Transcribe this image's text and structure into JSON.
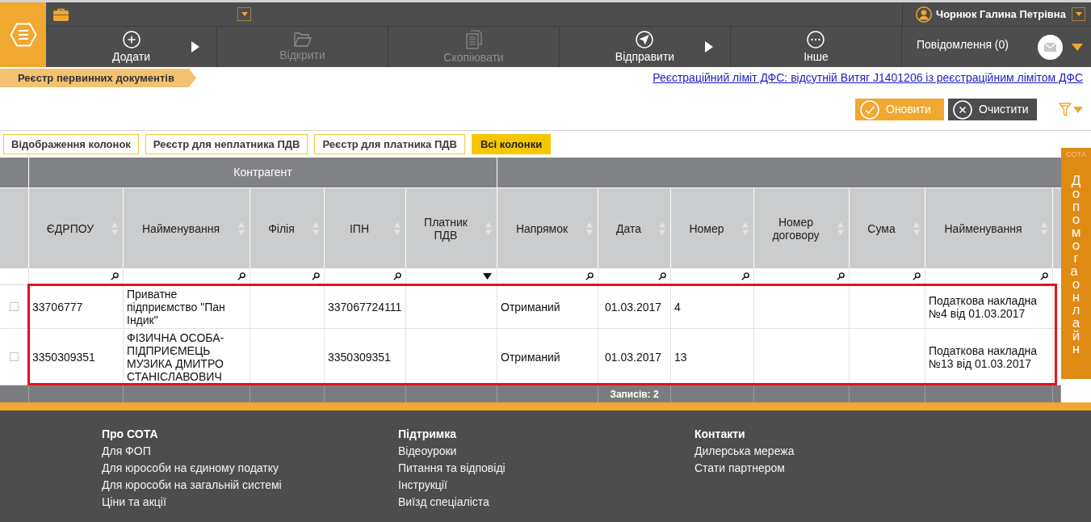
{
  "app_bar": {
    "user_name": "Чорнюк Галина Петрівна",
    "toolbar": [
      {
        "label": "Додати",
        "disabled": false,
        "has_submenu": true
      },
      {
        "label": "Відкрити",
        "disabled": true,
        "has_submenu": false
      },
      {
        "label": "Скопіювати",
        "disabled": true,
        "has_submenu": false
      },
      {
        "label": "Відправити",
        "disabled": false,
        "has_submenu": true
      },
      {
        "label": "Інше",
        "disabled": false,
        "has_submenu": false
      }
    ],
    "messages": "Повідомлення (0)"
  },
  "breadcrumb": "Реєстр первинних документів",
  "notice_link": "Реєстраційний ліміт ДФС: відсутній Витяг J1401206 із реєстраційним лімітом ДФС",
  "actions": [
    {
      "label": "Оновити",
      "kind": "primary"
    },
    {
      "label": "Очистити",
      "kind": "secondary"
    }
  ],
  "view_tabs": [
    {
      "label": "Відображення колонок",
      "selected": false
    },
    {
      "label": "Реєстр для неплатника ПДВ",
      "selected": false
    },
    {
      "label": "Реєстр для платника ПДВ",
      "selected": false
    },
    {
      "label": "Всі колонки",
      "selected": true
    }
  ],
  "table": {
    "column_groups": [
      {
        "label": "Контрагент",
        "columns": [
          {
            "label": "ЄДРПОУ",
            "kind": "search"
          },
          {
            "label": "Найменування",
            "kind": "search"
          },
          {
            "label": "Філія",
            "kind": "search"
          },
          {
            "label": "ІПН",
            "kind": "search"
          },
          {
            "label": "Платник ПДВ",
            "kind": "dropdown"
          }
        ]
      },
      {
        "columns": [
          {
            "label": "Напрямок",
            "kind": "search"
          },
          {
            "label": "Дата",
            "kind": "search"
          },
          {
            "label": "Номер",
            "kind": "search"
          },
          {
            "label": "Номер договору",
            "kind": "search"
          },
          {
            "label": "Сума",
            "kind": "search"
          },
          {
            "label": "Найменування",
            "kind": "search"
          }
        ]
      }
    ],
    "rows": [
      {
        "checked": false,
        "cells": [
          "33706777",
          "Приватне підприємство \"Пан Індик\"",
          null,
          "337067724111",
          null,
          "Отриманий",
          "01.03.2017",
          "4",
          null,
          null,
          "Податкова накладна №4 від 01.03.2017"
        ]
      },
      {
        "checked": false,
        "cells": [
          "3350309351",
          "ФІЗИЧНА ОСОБА-ПІДПРИЄМЕЦЬ МУЗИКА ДМИТРО СТАНІСЛАВОВИЧ",
          null,
          "3350309351",
          null,
          "Отриманий",
          "01.03.2017",
          "13",
          null,
          null,
          "Податкова накладна №13 від 01.03.2017"
        ]
      }
    ],
    "summary": "Записів: 2"
  },
  "help_panel": {
    "logo": "СОТА",
    "label": "Допомога онлайн"
  },
  "footer": {
    "columns": [
      {
        "title": "Про СОТА",
        "links": [
          "Для ФОП",
          "Для юрособи на єдиному податку",
          "Для юрособи на загальній системі",
          "Ціни та акції"
        ]
      },
      {
        "title": "Підтримка",
        "links": [
          "Відеоуроки",
          "Питання та відповіді",
          "Інструкції",
          "Виїзд спеціаліста"
        ]
      },
      {
        "title": "Контакти",
        "links": [
          "Дилерська мережа",
          "Стати партнером"
        ]
      }
    ]
  }
}
